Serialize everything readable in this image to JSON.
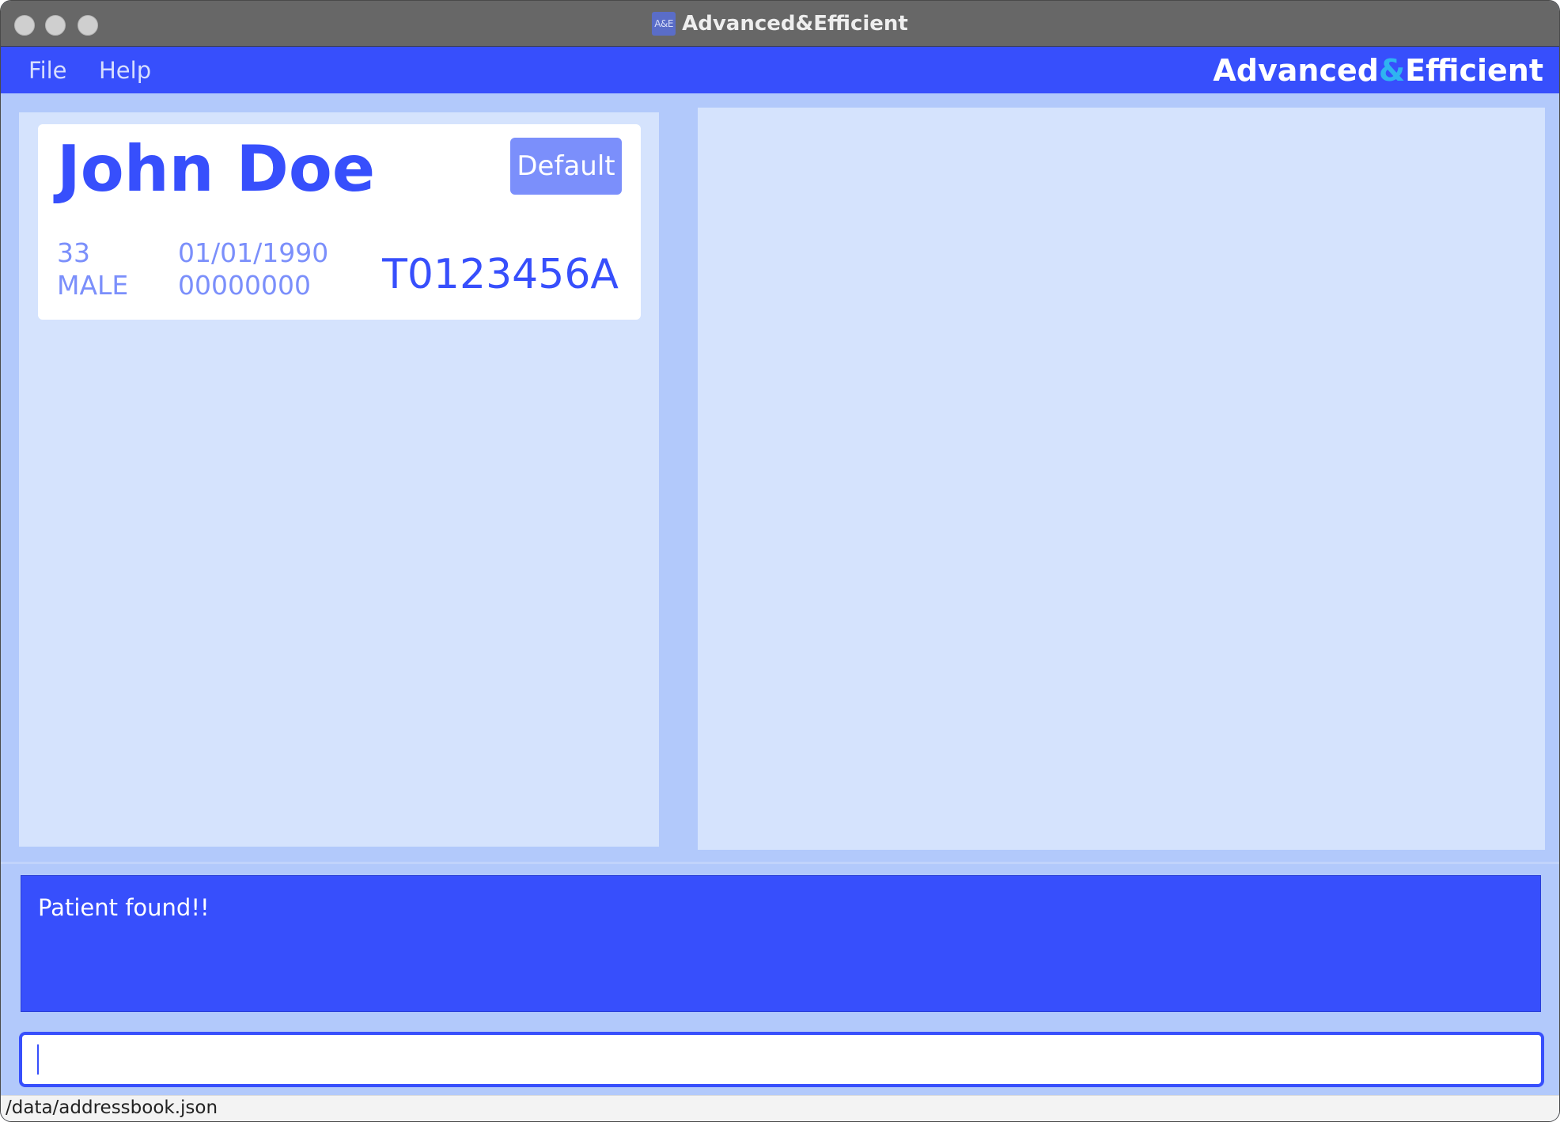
{
  "window": {
    "title": "Advanced&Efficient",
    "icon_label": "A&E"
  },
  "menu": {
    "items": [
      {
        "label": "File"
      },
      {
        "label": "Help"
      }
    ],
    "brand": {
      "part1": "Advanced",
      "amp": "&",
      "part2": "Efficient"
    }
  },
  "patient_list": {
    "patients": [
      {
        "name": "John Doe",
        "tag": "Default",
        "age": "33",
        "gender": "MALE",
        "birthday": "01/01/1990",
        "phone": "00000000",
        "nric": "T0123456A"
      }
    ]
  },
  "result_display": {
    "message": "Patient found!!"
  },
  "command_box": {
    "value": "",
    "placeholder": ""
  },
  "status_bar": {
    "save_path": "/data/addressbook.json"
  },
  "colors": {
    "primary": "#374ffc",
    "accent": "#2fb4f0",
    "tag": "#7b8ffb",
    "panel": "#d5e3fd",
    "background": "#b2c9fb"
  }
}
